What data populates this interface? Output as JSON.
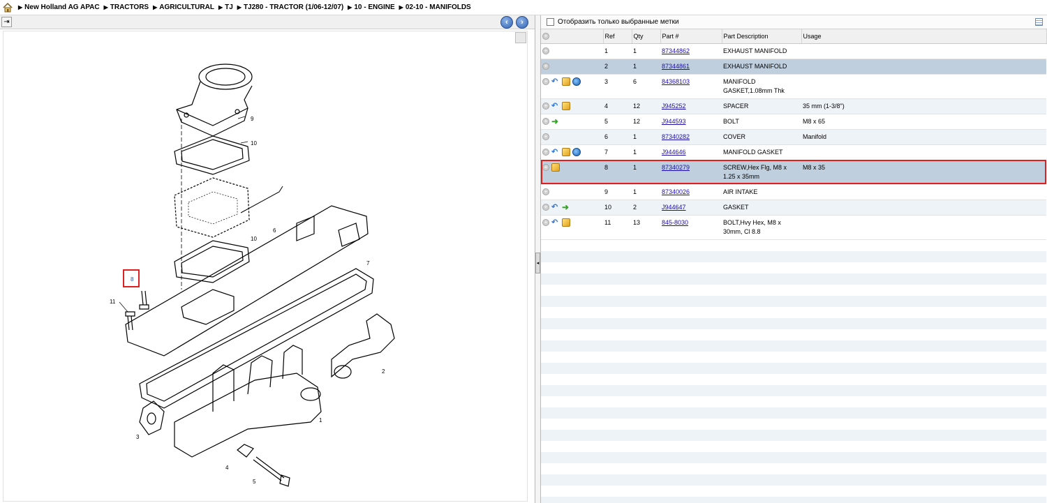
{
  "breadcrumb": {
    "items": [
      "New Holland AG APAC",
      "TRACTORS",
      "AGRICULTURAL",
      "TJ",
      "TJ280 - TRACTOR (1/06-12/07)",
      "10 - ENGINE",
      "02-10 - MANIFOLDS"
    ]
  },
  "icons": {
    "home": "home-icon",
    "back": "back-arrow-icon",
    "forward": "forward-arrow-icon",
    "box": "package-icon",
    "globe": "globe-icon",
    "plus": "plus-circle-icon"
  },
  "filter": {
    "label": "Отобразить только выбранные метки"
  },
  "table": {
    "headers": [
      "",
      "Ref",
      "Qty",
      "Part #",
      "Part Description",
      "Usage"
    ],
    "rows": [
      {
        "ref": "1",
        "qty": "1",
        "part": "87344862",
        "desc": "EXHAUST MANIFOLD",
        "usage": "",
        "icons": [],
        "state": "normal"
      },
      {
        "ref": "2",
        "qty": "1",
        "part": "87344861",
        "desc": "EXHAUST MANIFOLD",
        "usage": "",
        "icons": [],
        "state": "selected"
      },
      {
        "ref": "3",
        "qty": "6",
        "part": "84368103",
        "desc": "MANIFOLD GASKET,1.08mm Thk",
        "usage": "",
        "icons": [
          "back",
          "box",
          "globe"
        ],
        "state": "normal"
      },
      {
        "ref": "4",
        "qty": "12",
        "part": "J945252",
        "desc": "SPACER",
        "usage": "35 mm (1-3/8\")",
        "icons": [
          "back",
          "box"
        ],
        "state": "alt"
      },
      {
        "ref": "5",
        "qty": "12",
        "part": "J944593",
        "desc": "BOLT",
        "usage": "M8 x 65",
        "icons": [
          "forward"
        ],
        "state": "normal"
      },
      {
        "ref": "6",
        "qty": "1",
        "part": "87340282",
        "desc": "COVER",
        "usage": "Manifold",
        "icons": [],
        "state": "alt"
      },
      {
        "ref": "7",
        "qty": "1",
        "part": "J944646",
        "desc": "MANIFOLD GASKET",
        "usage": "",
        "icons": [
          "back",
          "box",
          "globe"
        ],
        "state": "normal"
      },
      {
        "ref": "8",
        "qty": "1",
        "part": "87340279",
        "desc": "SCREW,Hex Flg, M8 x 1.25 x 35mm",
        "usage": "M8 x 35",
        "icons": [
          "box"
        ],
        "state": "highlight"
      },
      {
        "ref": "9",
        "qty": "1",
        "part": "87340026",
        "desc": "AIR INTAKE",
        "usage": "",
        "icons": [],
        "state": "normal"
      },
      {
        "ref": "10",
        "qty": "2",
        "part": "J944647",
        "desc": "GASKET",
        "usage": "",
        "icons": [
          "back",
          "forward"
        ],
        "state": "alt"
      },
      {
        "ref": "11",
        "qty": "13",
        "part": "845-8030",
        "desc": "BOLT,Hvy Hex, M8 x 30mm, Cl 8.8",
        "usage": "",
        "icons": [
          "back",
          "box"
        ],
        "state": "normal"
      }
    ]
  },
  "drawing": {
    "callouts": [
      "9",
      "10",
      "6",
      "10",
      "7",
      "8",
      "11",
      "2",
      "1",
      "3",
      "4",
      "5"
    ],
    "highlighted_callout": "8"
  },
  "colors": {
    "highlight": "#e02020",
    "selected_row": "#bfcfdd",
    "link": "#1a0dab"
  }
}
